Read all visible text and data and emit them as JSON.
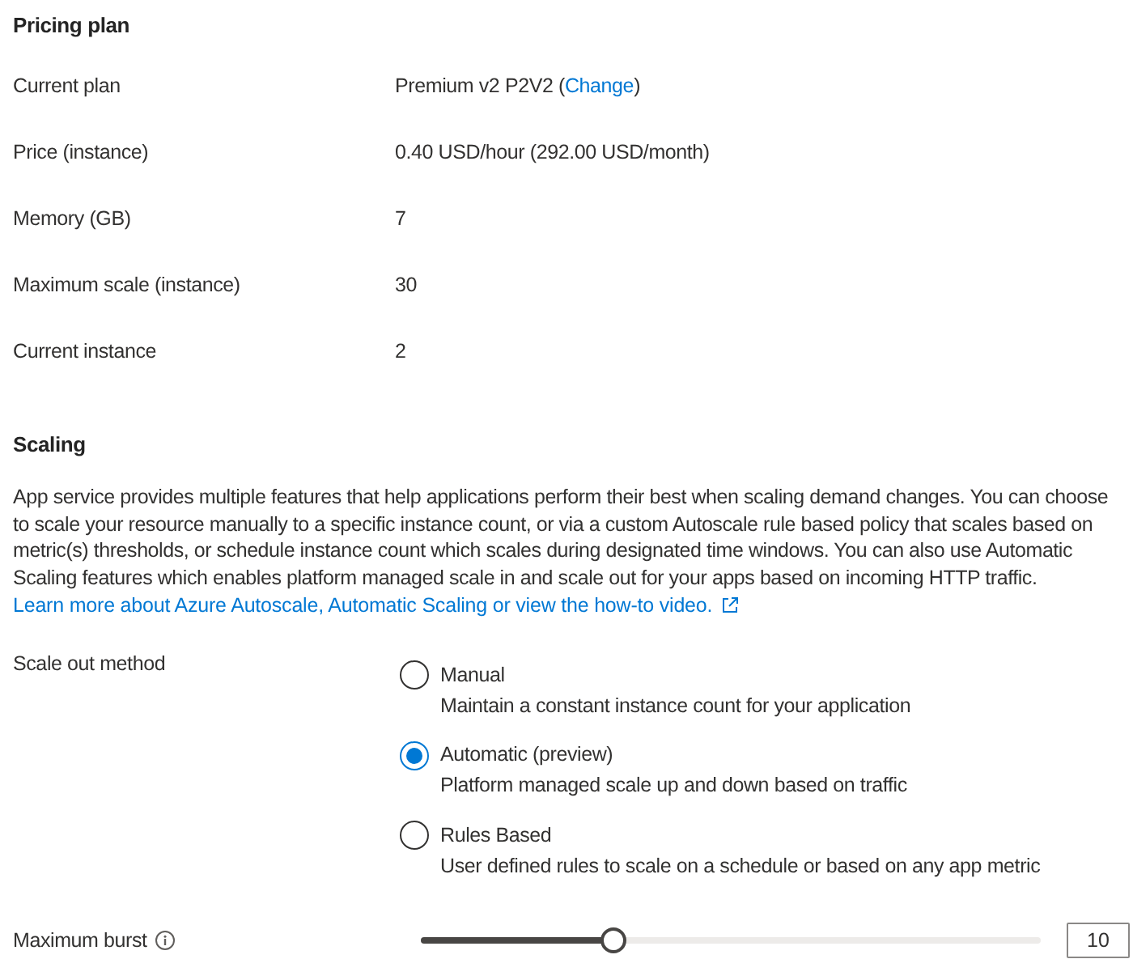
{
  "pricing_plan": {
    "title": "Pricing plan",
    "rows": [
      {
        "label": "Current plan",
        "value": "Premium v2 P2V2 (",
        "link": "Change",
        "value_end": ")"
      },
      {
        "label": "Price (instance)",
        "value": "0.40 USD/hour (292.00 USD/month)"
      },
      {
        "label": "Memory (GB)",
        "value": "7"
      },
      {
        "label": "Maximum scale (instance)",
        "value": "30"
      },
      {
        "label": "Current instance",
        "value": "2"
      }
    ]
  },
  "scaling": {
    "title": "Scaling",
    "description": "App service provides multiple features that help applications perform their best when scaling demand changes. You can choose to scale your resource manually to a specific instance count, or via a custom Autoscale rule based policy that scales based on metric(s) thresholds, or schedule instance count which scales during designated time windows. You can also use Automatic Scaling features which enables platform managed scale in and scale out for your apps based on incoming HTTP traffic.",
    "link": "Learn more about Azure Autoscale, Automatic Scaling or view the how-to video.",
    "scale_out_method": {
      "label": "Scale out method",
      "options": [
        {
          "label": "Manual",
          "description": "Maintain a constant instance count for your application",
          "selected": false
        },
        {
          "label": "Automatic (preview)",
          "description": "Platform managed scale up and down based on traffic",
          "selected": true
        },
        {
          "label": "Rules Based",
          "description": "User defined rules to scale on a schedule or based on any app metric",
          "selected": false
        }
      ]
    },
    "maximum_burst": {
      "label": "Maximum burst",
      "level": 0.31,
      "value": "10"
    }
  }
}
